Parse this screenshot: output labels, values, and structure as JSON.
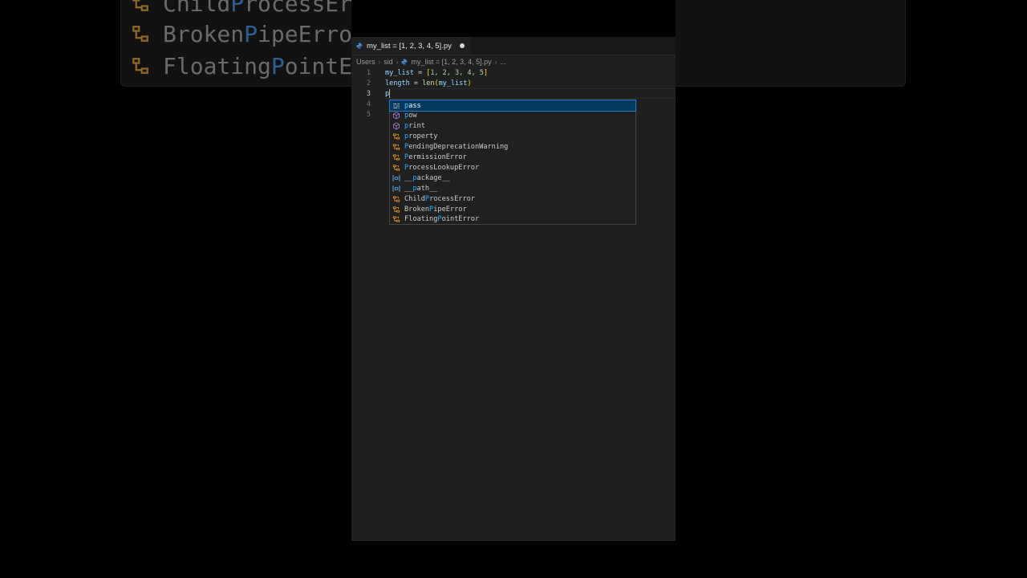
{
  "background_zoom": {
    "rows": [
      {
        "pre": "Child",
        "match": "P",
        "post": "rocessErr"
      },
      {
        "pre": "Broken",
        "match": "P",
        "post": "ipeError"
      },
      {
        "pre": "Floating",
        "match": "P",
        "post": "ointEr"
      }
    ]
  },
  "tab": {
    "title": "my_list = [1, 2, 3, 4, 5].py"
  },
  "breadcrumb": {
    "items": [
      "Users",
      "sid",
      "my_list = [1, 2, 3, 4, 5].py",
      "..."
    ]
  },
  "code": {
    "line_numbers": [
      "1",
      "2",
      "3",
      "4",
      "5"
    ],
    "line1": {
      "var": "my_list",
      "eq": " = ",
      "open": "[",
      "nums": "1, 2, 3, 4, 5",
      "close": "]"
    },
    "line2": {
      "var": "length",
      "eq": " = ",
      "fn": "len",
      "open": "(",
      "arg": "my_list",
      "close": ")"
    },
    "line3": {
      "text": "p"
    }
  },
  "suggestions": [
    {
      "kind": "keyword",
      "match": "p",
      "rest": "ass",
      "selected": true
    },
    {
      "kind": "function",
      "match": "p",
      "rest": "ow"
    },
    {
      "kind": "function",
      "match": "p",
      "rest": "rint"
    },
    {
      "kind": "class",
      "match": "p",
      "rest": "roperty"
    },
    {
      "kind": "class",
      "match": "P",
      "rest": "endingDeprecationWarning"
    },
    {
      "kind": "class",
      "match": "P",
      "rest": "ermissionError"
    },
    {
      "kind": "class",
      "match": "P",
      "rest": "rocessLookupError"
    },
    {
      "kind": "variable",
      "pre": "__",
      "match": "p",
      "rest": "ackage__"
    },
    {
      "kind": "variable",
      "pre": "__",
      "match": "p",
      "rest": "ath__"
    },
    {
      "kind": "class",
      "pre": "Child",
      "match": "P",
      "rest": "rocessError"
    },
    {
      "kind": "class",
      "pre": "Broken",
      "match": "P",
      "rest": "ipeError"
    },
    {
      "kind": "class",
      "pre": "Floating",
      "match": "P",
      "rest": "ointError"
    }
  ],
  "colors": {
    "accent": "#2b79c4",
    "selection_bg": "#04395e",
    "match_highlight": "#2aaaff",
    "class_icon": "#ee9d28",
    "function_icon": "#b180d7",
    "variable_icon": "#75beff"
  }
}
